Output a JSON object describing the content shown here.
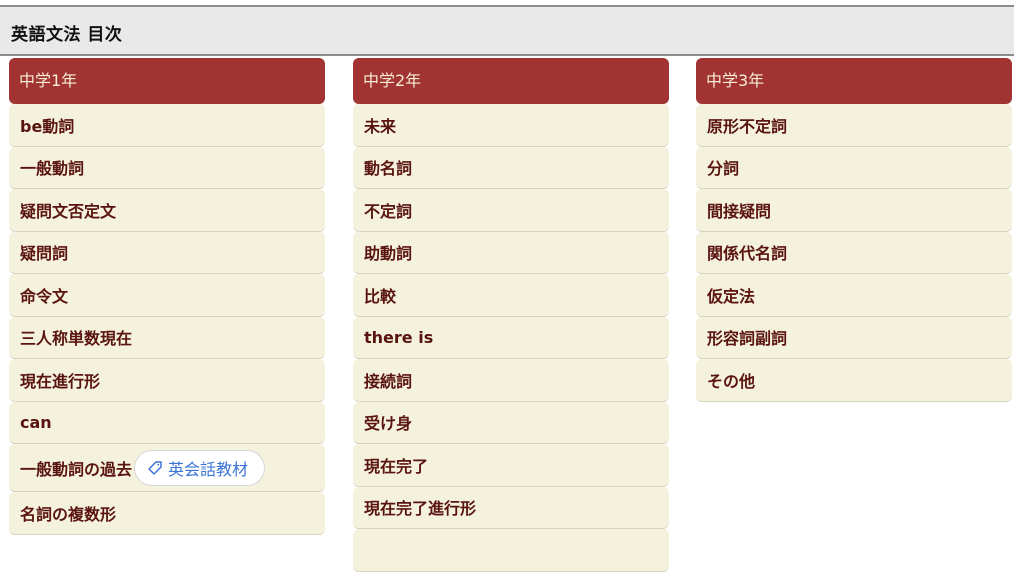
{
  "page": {
    "title": "英語文法 目次"
  },
  "columns": [
    {
      "header": "中学1年",
      "items": [
        {
          "label": "be動詞"
        },
        {
          "label": "一般動詞"
        },
        {
          "label": "疑問文否定文"
        },
        {
          "label": "疑問詞"
        },
        {
          "label": "命令文"
        },
        {
          "label": "三人称単数現在"
        },
        {
          "label": "現在進行形"
        },
        {
          "label": "can"
        },
        {
          "label": "一般動詞の過去",
          "chip": {
            "icon": "tag-icon",
            "label": "英会話教材"
          }
        },
        {
          "label": "名詞の複数形"
        }
      ]
    },
    {
      "header": "中学2年",
      "items": [
        {
          "label": "未来"
        },
        {
          "label": "動名詞"
        },
        {
          "label": "不定詞"
        },
        {
          "label": "助動詞"
        },
        {
          "label": "比較"
        },
        {
          "label": "there is"
        },
        {
          "label": "接続詞"
        },
        {
          "label": "受け身"
        },
        {
          "label": "現在完了"
        },
        {
          "label": "現在完了進行形"
        }
      ]
    },
    {
      "header": "中学3年",
      "items": [
        {
          "label": "原形不定詞"
        },
        {
          "label": "分詞"
        },
        {
          "label": "間接疑問"
        },
        {
          "label": "関係代名詞"
        },
        {
          "label": "仮定法"
        },
        {
          "label": "形容詞副詞"
        },
        {
          "label": "その他"
        }
      ]
    }
  ],
  "colors": {
    "header_bg": "#a13432",
    "header_text": "#f6ecd8",
    "item_bg": "#f4f2dc",
    "item_text": "#5a1410",
    "title_bar_bg": "#e9e9e9",
    "chip_text": "#3b73d6"
  }
}
